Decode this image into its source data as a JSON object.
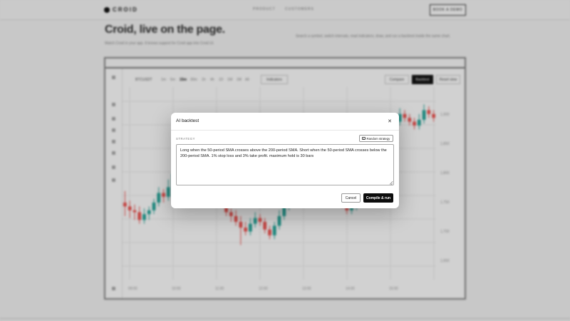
{
  "page": {
    "brand": "CROID",
    "nav": [
      "PRODUCT",
      "CUSTOMERS"
    ],
    "cta": "BOOK A DEMO",
    "hero_title": "Croid, live on the page.",
    "hero_sub": "Watch Croid in your app. It knows support for Croid app into Croid UI.",
    "hero_side": "Search a symbol, switch intervals, read indicators, draw, and run a backtest inside the same chart."
  },
  "chart": {
    "symbol": "BTCUSDT",
    "timeframes": [
      "1m",
      "5m",
      "15m",
      "30m",
      "1h",
      "4h",
      "1D",
      "1W",
      "1M",
      "All"
    ],
    "active_timeframe": "15m",
    "indicators_label": "Indicators",
    "right_buttons": [
      "Compare",
      "Backtest",
      "Reset view"
    ],
    "price_labels": [
      "1,900",
      "1,850",
      "1,800",
      "1,750",
      "1,700",
      "1,650"
    ],
    "time_labels": [
      "09:00",
      "10:00",
      "11:00",
      "12:00",
      "13:00",
      "14:00",
      "15:00"
    ],
    "up_color": "#26a69a",
    "down_color": "#ef5350",
    "candles": [
      [
        40,
        38,
        46,
        33
      ],
      [
        38,
        36,
        41,
        32
      ],
      [
        36,
        35,
        39,
        31
      ],
      [
        35,
        31,
        38,
        29
      ],
      [
        31,
        34,
        37,
        29
      ],
      [
        34,
        36,
        38,
        31
      ],
      [
        36,
        40,
        42,
        34
      ],
      [
        40,
        45,
        48,
        38
      ],
      [
        45,
        43,
        47,
        40
      ],
      [
        43,
        48,
        52,
        41
      ],
      [
        48,
        55,
        58,
        46
      ],
      [
        55,
        60,
        63,
        53
      ],
      [
        60,
        57,
        62,
        54
      ],
      [
        57,
        61,
        65,
        55
      ],
      [
        61,
        59,
        64,
        56
      ],
      [
        59,
        63,
        67,
        57
      ],
      [
        63,
        62,
        66,
        59
      ],
      [
        62,
        58,
        64,
        55
      ],
      [
        58,
        53,
        60,
        50
      ],
      [
        53,
        48,
        55,
        45
      ],
      [
        48,
        40,
        50,
        38
      ],
      [
        40,
        35,
        42,
        33
      ],
      [
        35,
        33,
        37,
        30
      ],
      [
        33,
        30,
        36,
        28
      ],
      [
        30,
        27,
        33,
        18
      ],
      [
        27,
        25,
        30,
        23
      ],
      [
        25,
        29,
        32,
        23
      ],
      [
        29,
        32,
        35,
        27
      ],
      [
        32,
        30,
        34,
        28
      ],
      [
        30,
        26,
        32,
        24
      ],
      [
        26,
        23,
        28,
        21
      ],
      [
        23,
        28,
        30,
        21
      ],
      [
        28,
        33,
        36,
        26
      ],
      [
        33,
        38,
        41,
        31
      ],
      [
        38,
        42,
        44,
        36
      ],
      [
        42,
        45,
        48,
        40
      ],
      [
        45,
        49,
        52,
        43
      ],
      [
        49,
        46,
        51,
        44
      ],
      [
        46,
        51,
        54,
        44
      ],
      [
        51,
        55,
        57,
        49
      ],
      [
        55,
        57,
        60,
        53
      ],
      [
        57,
        54,
        59,
        51
      ],
      [
        54,
        50,
        56,
        48
      ],
      [
        50,
        46,
        52,
        44
      ],
      [
        46,
        42,
        48,
        40
      ],
      [
        42,
        39,
        44,
        37
      ],
      [
        39,
        36,
        41,
        34
      ],
      [
        36,
        38,
        40,
        34
      ],
      [
        38,
        45,
        48,
        36
      ],
      [
        45,
        52,
        55,
        43
      ],
      [
        52,
        58,
        60,
        50
      ],
      [
        58,
        63,
        66,
        56
      ],
      [
        63,
        70,
        72,
        61
      ],
      [
        70,
        75,
        78,
        68
      ],
      [
        75,
        80,
        83,
        73
      ],
      [
        80,
        78,
        82,
        76
      ],
      [
        78,
        82,
        85,
        76
      ],
      [
        82,
        86,
        89,
        80
      ],
      [
        86,
        84,
        88,
        82
      ],
      [
        84,
        82,
        86,
        80
      ],
      [
        82,
        80,
        84,
        78
      ],
      [
        80,
        83,
        86,
        78
      ],
      [
        83,
        88,
        91,
        81
      ],
      [
        88,
        86,
        90,
        84
      ],
      [
        86,
        84,
        88,
        82
      ]
    ]
  },
  "modal": {
    "title": "AI backtest",
    "close_icon": "close-icon",
    "section_label": "STRATEGY",
    "random_label": "Random strategy",
    "random_icon": "dice-icon",
    "strategy_text": "Long when the 50-period SMA crosses above the 200-period SMA. Short when the 50-period SMA crosses below the 200-period SMA. 1% stop loss and 3% take profit. maximum hold is 30 bars",
    "cancel_label": "Cancel",
    "run_label": "Compile & run"
  }
}
